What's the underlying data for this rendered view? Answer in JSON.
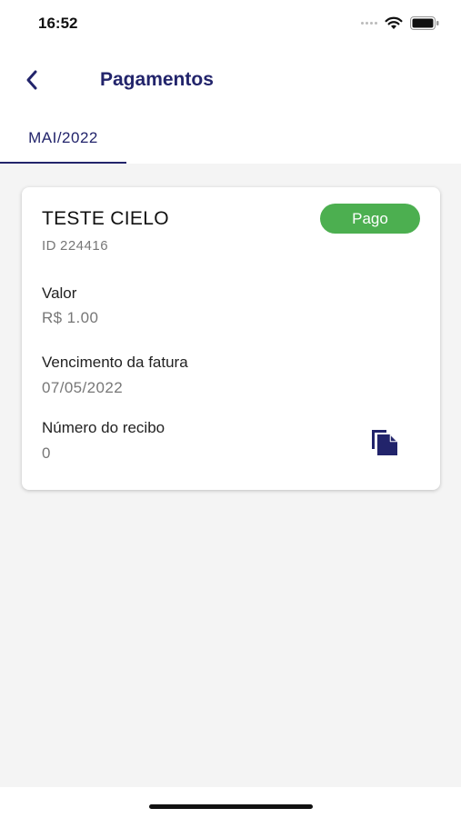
{
  "status_bar": {
    "time": "16:52"
  },
  "header": {
    "title": "Pagamentos",
    "back_icon": "chevron-left-icon"
  },
  "tabs": [
    {
      "label": "MAI/2022",
      "active": true
    }
  ],
  "payment": {
    "title": "TESTE CIELO",
    "id_prefix": "ID",
    "id_value": "224416",
    "status": "Pago",
    "status_color": "#4caf50",
    "fields": [
      {
        "label": "Valor",
        "value": "R$ 1.00"
      },
      {
        "label": "Vencimento da fatura",
        "value": "07/05/2022"
      },
      {
        "label": "Número do recibo",
        "value": "0"
      }
    ],
    "copy_icon": "copy-document-icon"
  },
  "colors": {
    "primary": "#22246b",
    "success": "#4caf50",
    "background": "#f4f4f4"
  }
}
